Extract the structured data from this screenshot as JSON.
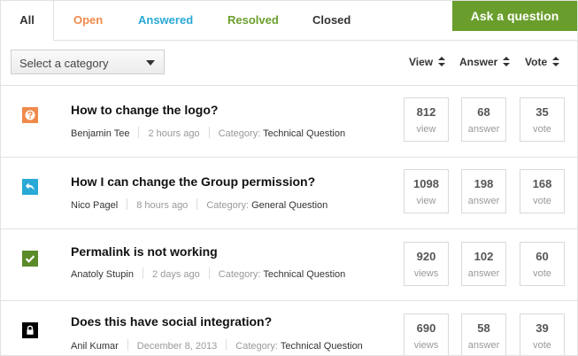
{
  "tabs": [
    {
      "label": "All",
      "color": "#333333"
    },
    {
      "label": "Open",
      "color": "#f08a4b"
    },
    {
      "label": "Answered",
      "color": "#29a9d6"
    },
    {
      "label": "Resolved",
      "color": "#6a9e2c"
    },
    {
      "label": "Closed",
      "color": "#333333"
    }
  ],
  "ask_button": {
    "label": "Ask a question",
    "color": "#6a9e2c"
  },
  "category_select": {
    "label": "Select a category"
  },
  "sort_headers": {
    "view": "View",
    "answer": "Answer",
    "vote": "Vote"
  },
  "questions": [
    {
      "icon": "question-mark-icon",
      "icon_color": "#f08a4b",
      "title": "How to change the logo?",
      "author": "Benjamin Tee",
      "time": "2 hours ago",
      "category_label": "Category:",
      "category": "Technical Question",
      "views": "812",
      "views_label": "view",
      "answers": "68",
      "answers_label": "answer",
      "votes": "35",
      "votes_label": "vote"
    },
    {
      "icon": "reply-arrow-icon",
      "icon_color": "#29a9d6",
      "title": "How I can change the Group permission?",
      "author": "Nico Pagel",
      "time": "8 hours ago",
      "category_label": "Category:",
      "category": "General Question",
      "views": "1098",
      "views_label": "view",
      "answers": "198",
      "answers_label": "answer",
      "votes": "168",
      "votes_label": "vote"
    },
    {
      "icon": "checkmark-icon",
      "icon_color": "#5b8a2a",
      "title": "Permalink is not working",
      "author": "Anatoly Stupin",
      "time": "2 days ago",
      "category_label": "Category:",
      "category": "Technical Question",
      "views": "920",
      "views_label": "views",
      "answers": "102",
      "answers_label": "answer",
      "votes": "60",
      "votes_label": "vote"
    },
    {
      "icon": "lock-icon",
      "icon_color": "#000000",
      "title": "Does this have social integration?",
      "author": "Anil Kumar",
      "time": "December 8, 2013",
      "category_label": "Category:",
      "category": "Technical Question",
      "views": "690",
      "views_label": "views",
      "answers": "58",
      "answers_label": "answer",
      "votes": "39",
      "votes_label": "vote"
    }
  ]
}
